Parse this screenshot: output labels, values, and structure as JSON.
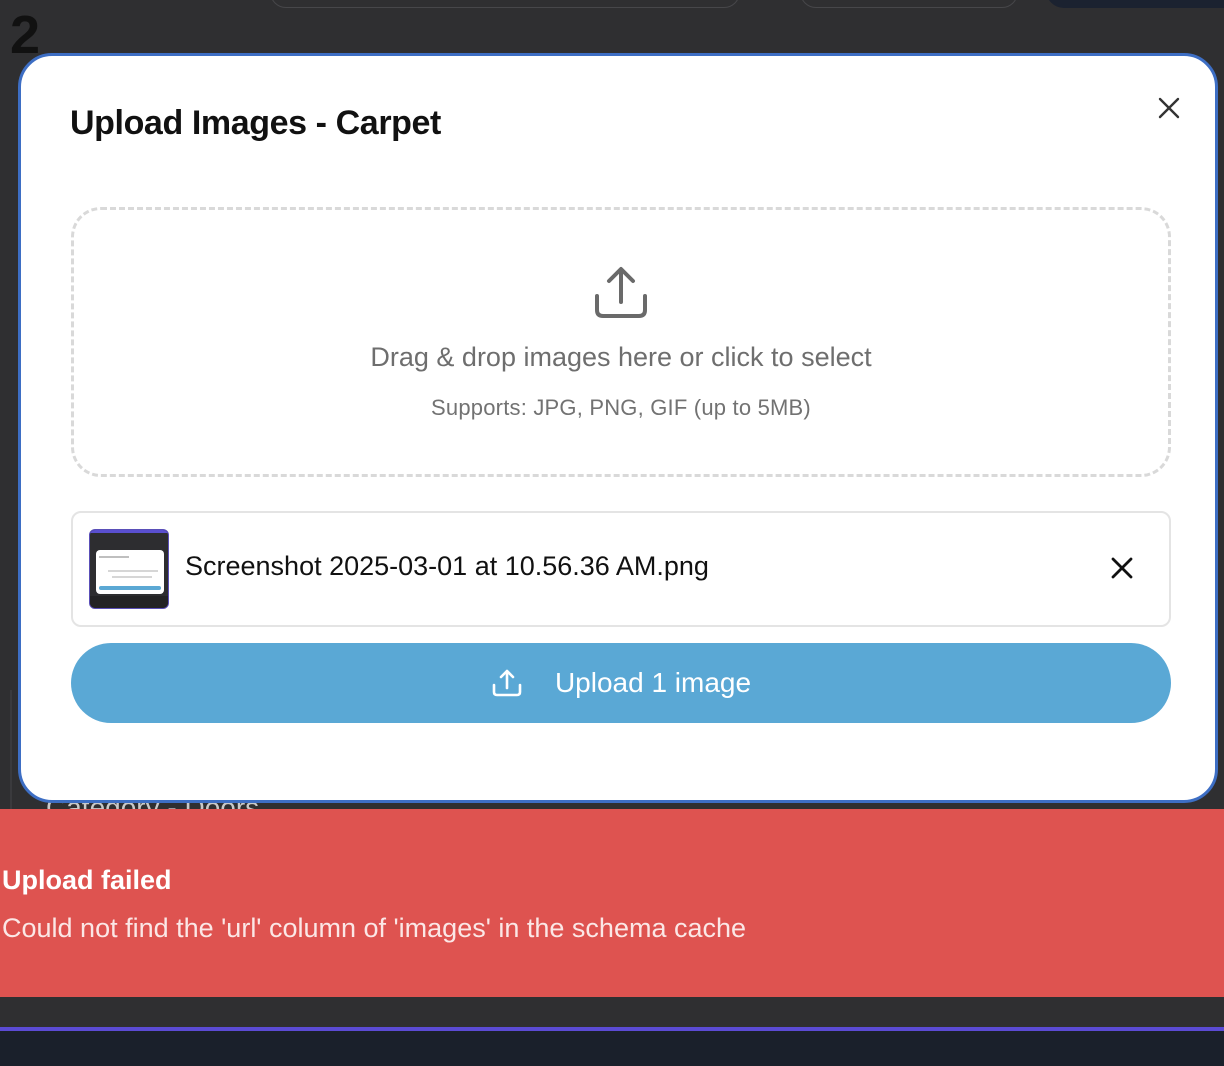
{
  "step_number": "2",
  "background": {
    "peek_text": "Category - Doors"
  },
  "modal": {
    "title": "Upload Images - Carpet",
    "close_icon": "close-icon"
  },
  "dropzone": {
    "icon": "upload-icon",
    "main_text": "Drag & drop images here or click to select",
    "sub_text": "Supports: JPG, PNG, GIF (up to 5MB)"
  },
  "files": [
    {
      "name": "Screenshot 2025-03-01 at 10.56.36 AM.png",
      "thumbnail_icon": "image-thumbnail",
      "remove_icon": "remove-icon"
    }
  ],
  "upload_button": {
    "label": "Upload 1 image",
    "icon": "upload-icon",
    "color": "#5aa8d5"
  },
  "toast": {
    "title": "Upload failed",
    "message": "Could not find the 'url' column of 'images' in the schema cache",
    "color": "#de5350"
  },
  "colors": {
    "modal_border": "#3d6ec4",
    "bottom_accent": "#5b4bd4"
  }
}
